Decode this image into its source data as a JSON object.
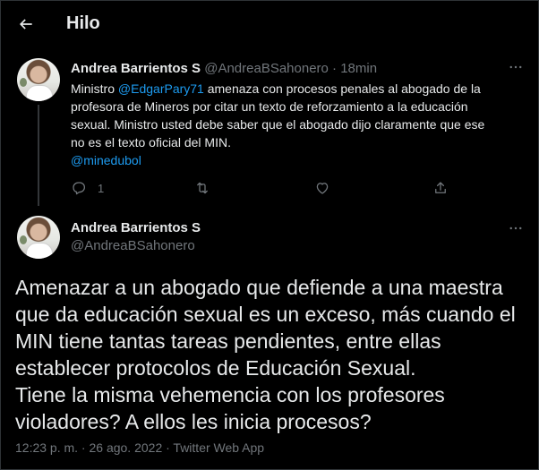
{
  "header": {
    "title": "Hilo",
    "back_icon": "arrow-left-icon"
  },
  "colors": {
    "background": "#000000",
    "text_primary": "#e7e9ea",
    "text_secondary": "#71767b",
    "accent": "#1d9bf0",
    "divider": "#2f3336"
  },
  "parent_tweet": {
    "name": "Andrea Barrientos S",
    "handle": "@AndreaBSahonero",
    "separator": "·",
    "time": "18min",
    "text_parts": [
      "Ministro ",
      "@EdgarPary71",
      " amenaza con procesos penales al abogado de la\nprofesora de Mineros por citar un texto de reforzamiento a la educación\nsexual. Ministro usted debe saber que el abogado dijo claramente que ese\nno es el texto oficial del MIN.\n",
      "@minedubol"
    ],
    "more_icon": "more-horizontal-icon",
    "actions": {
      "reply_icon": "reply-icon",
      "reply_count": "1",
      "retweet_icon": "retweet-icon",
      "retweet_count": "",
      "like_icon": "heart-icon",
      "like_count": "",
      "share_icon": "share-icon"
    }
  },
  "main_tweet": {
    "name": "Andrea Barrientos S",
    "handle": "@AndreaBSahonero",
    "more_icon": "more-horizontal-icon",
    "text": "Amenazar a un abogado que defiende a una maestra\nque da educación sexual es un exceso, más cuando el\nMIN tiene tantas tareas pendientes, entre ellas\nestablecer protocolos de Educación Sexual.\nTiene la misma vehemencia con los profesores\nvioladores? A ellos les inicia procesos?",
    "timestamp": "12:23 p. m. · 26 ago. 2022 · Twitter Web App"
  }
}
